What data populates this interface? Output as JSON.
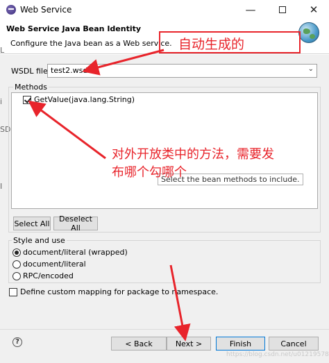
{
  "window": {
    "title": "Web Service",
    "controls": {
      "minimize": "—",
      "close": "✕"
    }
  },
  "banner": {
    "title": "Web Service Java Bean Identity",
    "description": "Configure the Java bean as a Web service."
  },
  "wsdl": {
    "label": "WSDL file:",
    "value": "test2.wsdl"
  },
  "methods": {
    "legend": "Methods",
    "items": [
      {
        "label": "GetValue(java.lang.String)",
        "checked": true
      }
    ],
    "hint": "Select the bean methods to include.",
    "select_all": "Select All",
    "deselect_all": "Deselect All"
  },
  "style": {
    "legend": "Style and use",
    "options": [
      {
        "label": "document/literal (wrapped)",
        "selected": true
      },
      {
        "label": "document/literal",
        "selected": false
      },
      {
        "label": "RPC/encoded",
        "selected": false
      }
    ]
  },
  "custom_mapping": {
    "label": "Define custom mapping for package to namespace.",
    "checked": false
  },
  "footer": {
    "help": "?",
    "back": "< Back",
    "next": "Next >",
    "finish": "Finish",
    "cancel": "Cancel"
  },
  "watermark": "https://blog.csdn.net/u012195780",
  "annotations": {
    "top_note": "自动生成的",
    "mid_note_line1": "对外开放类中的方法，需要发",
    "mid_note_line2": "布哪个勾哪个",
    "color": "#e8242b"
  },
  "background_slivers": [
    "L",
    "i",
    "SD",
    "I"
  ]
}
